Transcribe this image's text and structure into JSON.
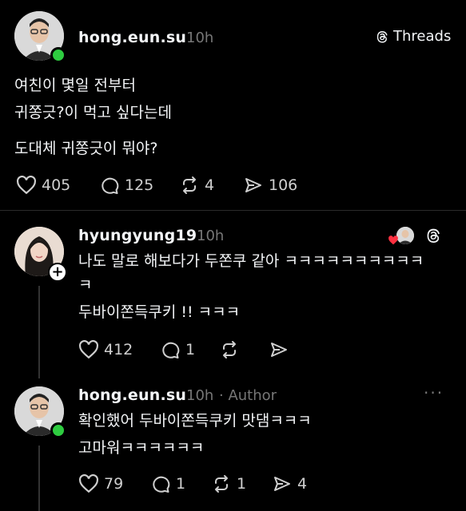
{
  "header": {
    "app_label": "Threads"
  },
  "post": {
    "username": "hong.eun.su",
    "time": "10h",
    "lines": [
      "여친이 몇일 전부터",
      "귀쫑긋?이 먹고 싶다는데",
      "도대체 귀쫑긋이 뭐야?"
    ],
    "likes": "405",
    "replies": "125",
    "reposts": "4",
    "shares": "106"
  },
  "reply1": {
    "username": "hyungyung19",
    "time": "10h",
    "lines": [
      "나도 말로 해보다가 두쫀쿠 같아 ㅋㅋㅋㅋㅋㅋㅋㅋㅋㅋ",
      "ㅋ",
      "두바이쫀득쿠키 !! ㅋㅋㅋ"
    ],
    "likes": "412",
    "replies": "1"
  },
  "reply2": {
    "username": "hong.eun.su",
    "time": "10h",
    "author_tag": "· Author",
    "lines": [
      "확인했어 두바이쫀득쿠키 맛댐ㅋㅋㅋ",
      "고마워ㅋㅋㅋㅋㅋㅋ"
    ],
    "likes": "79",
    "replies": "1",
    "reposts": "1",
    "shares": "4"
  },
  "icons": [
    "heart-icon",
    "comment-icon",
    "repost-icon",
    "share-icon",
    "threads-logo-icon",
    "more-icon"
  ],
  "colors": {
    "background": "#000000",
    "text": "#f3f5f7",
    "muted": "#777777",
    "online": "#2ecc40",
    "like_heart": "#ff3040"
  }
}
